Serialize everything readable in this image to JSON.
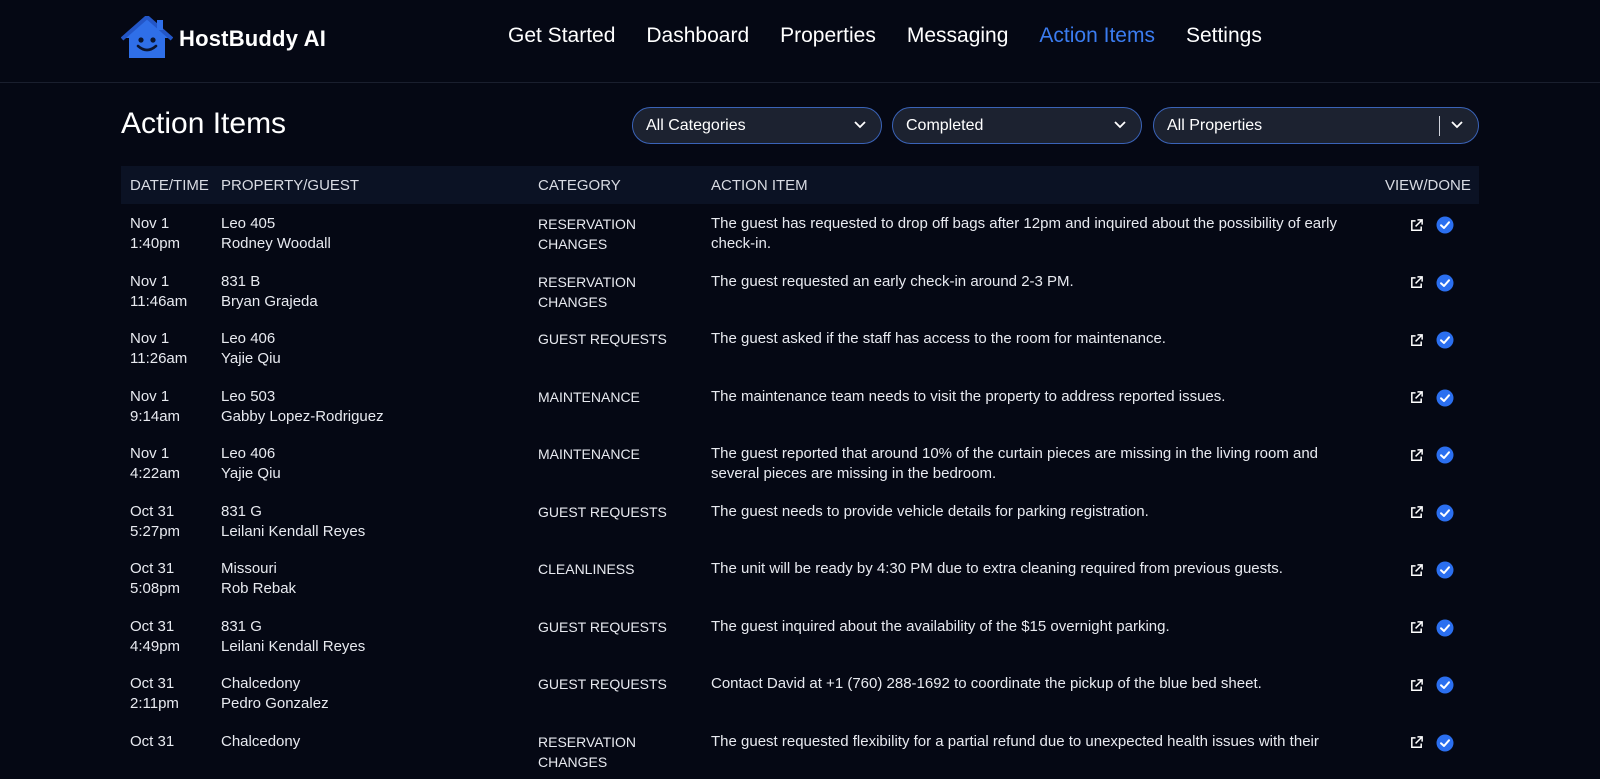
{
  "brand": {
    "name": "HostBuddy AI",
    "logo_icon": "house-smiley-icon",
    "accent": "#3b7cf0"
  },
  "nav": [
    {
      "label": "Get Started",
      "active": false
    },
    {
      "label": "Dashboard",
      "active": false
    },
    {
      "label": "Properties",
      "active": false
    },
    {
      "label": "Messaging",
      "active": false
    },
    {
      "label": "Action Items",
      "active": true
    },
    {
      "label": "Settings",
      "active": false
    }
  ],
  "page": {
    "title": "Action Items"
  },
  "filters": {
    "category": "All Categories",
    "status": "Completed",
    "property": "All Properties"
  },
  "table": {
    "headers": [
      "DATE/TIME",
      "PROPERTY/GUEST",
      "CATEGORY",
      "ACTION ITEM",
      "VIEW/DONE"
    ],
    "rows": [
      {
        "date": "Nov 1",
        "time": "1:40pm",
        "property": "Leo 405",
        "guest": "Rodney Woodall",
        "category": "RESERVATION CHANGES",
        "action": "The guest has requested to drop off bags after 12pm and inquired about the possibility of early check-in."
      },
      {
        "date": "Nov 1",
        "time": "11:46am",
        "property": "831 B",
        "guest": "Bryan Grajeda",
        "category": "RESERVATION CHANGES",
        "action": "The guest requested an early check-in around 2-3 PM."
      },
      {
        "date": "Nov 1",
        "time": "11:26am",
        "property": "Leo 406",
        "guest": "Yajie Qiu",
        "category": "GUEST REQUESTS",
        "action": "The guest asked if the staff has access to the room for maintenance."
      },
      {
        "date": "Nov 1",
        "time": "9:14am",
        "property": "Leo 503",
        "guest": "Gabby Lopez-Rodriguez",
        "category": "MAINTENANCE",
        "action": "The maintenance team needs to visit the property to address reported issues."
      },
      {
        "date": "Nov 1",
        "time": "4:22am",
        "property": "Leo 406",
        "guest": "Yajie Qiu",
        "category": "MAINTENANCE",
        "action": "The guest reported that around 10% of the curtain pieces are missing in the living room and several pieces are missing in the bedroom."
      },
      {
        "date": "Oct 31",
        "time": "5:27pm",
        "property": "831 G",
        "guest": "Leilani Kendall Reyes",
        "category": "GUEST REQUESTS",
        "action": "The guest needs to provide vehicle details for parking registration."
      },
      {
        "date": "Oct 31",
        "time": "5:08pm",
        "property": "Missouri",
        "guest": "Rob Rebak",
        "category": "CLEANLINESS",
        "action": "The unit will be ready by 4:30 PM due to extra cleaning required from previous guests."
      },
      {
        "date": "Oct 31",
        "time": "4:49pm",
        "property": "831 G",
        "guest": "Leilani Kendall Reyes",
        "category": "GUEST REQUESTS",
        "action": "The guest inquired about the availability of the $15 overnight parking."
      },
      {
        "date": "Oct 31",
        "time": "2:11pm",
        "property": "Chalcedony",
        "guest": "Pedro Gonzalez",
        "category": "GUEST REQUESTS",
        "action": "Contact David at +1 (760) 288-1692 to coordinate the pickup of the blue bed sheet."
      },
      {
        "date": "Oct 31",
        "time": "",
        "property": "Chalcedony",
        "guest": "",
        "category": "RESERVATION CHANGES",
        "action": "The guest requested flexibility for a partial refund due to unexpected health issues with their"
      }
    ]
  },
  "icons": {
    "view": "external-link-icon",
    "done": "check-circle-icon",
    "dropdown": "chevron-down-icon"
  }
}
